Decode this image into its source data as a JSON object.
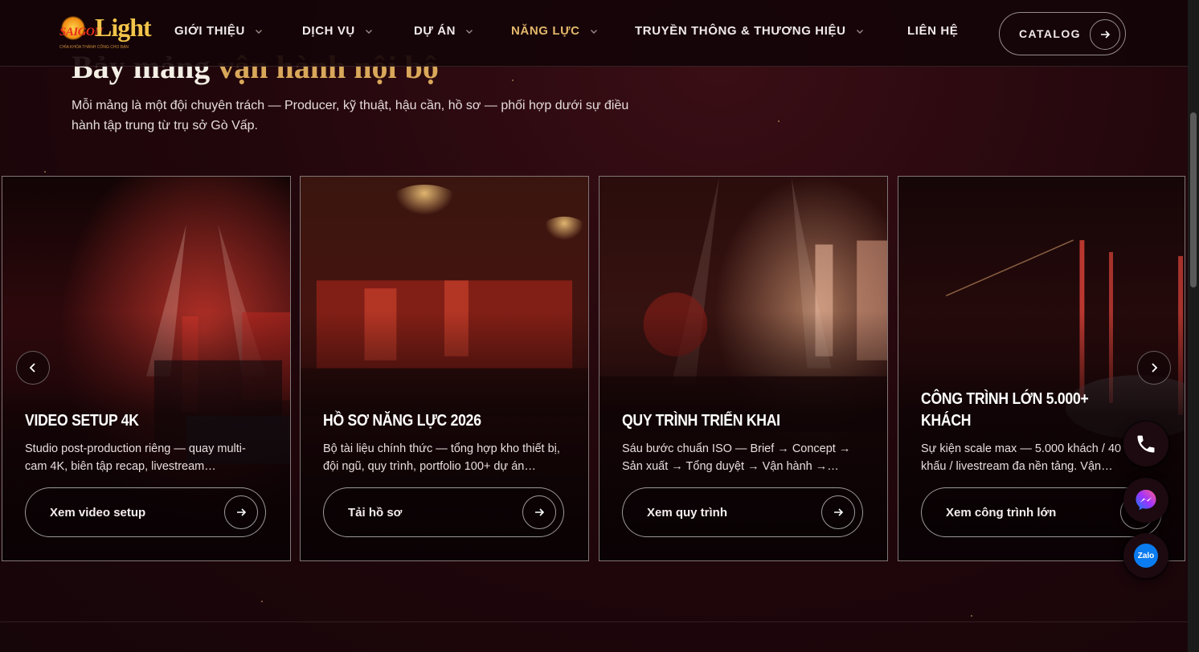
{
  "brand": {
    "name_left": "SAIGON",
    "name_right": "Light",
    "tagline": "CHÌA KHÓA THÀNH CÔNG CHO BẠN"
  },
  "nav": {
    "items": [
      {
        "label": "GIỚI THIỆU",
        "has_dropdown": true,
        "active": false
      },
      {
        "label": "DỊCH VỤ",
        "has_dropdown": true,
        "active": false
      },
      {
        "label": "DỰ ÁN",
        "has_dropdown": true,
        "active": false
      },
      {
        "label": "NĂNG LỰC",
        "has_dropdown": true,
        "active": true
      },
      {
        "label": "TRUYỀN THÔNG & THƯƠNG HIỆU",
        "has_dropdown": true,
        "active": false
      },
      {
        "label": "LIÊN HỆ",
        "has_dropdown": false,
        "active": false
      }
    ],
    "catalog_label": "CATALOG"
  },
  "section": {
    "heading_plain": "Bảy mảng ",
    "heading_accent": "vận hành nội bộ",
    "subtitle": "Mỗi mảng là một đội chuyên trách — Producer, kỹ thuật, hậu cần, hồ sơ — phối hợp dưới sự điều hành tập trung từ trụ sở Gò Vấp."
  },
  "cards": [
    {
      "title": "VIDEO SETUP 4K",
      "description": "Studio post-production riêng — quay multi-cam 4K, biên tập recap, livestream…",
      "button_label": "Xem video setup"
    },
    {
      "title": "HỒ SƠ NĂNG LỰC 2026",
      "description": "Bộ tài liệu chính thức — tổng hợp kho thiết bị, đội ngũ, quy trình, portfolio 100+ dự án…",
      "button_label": "Tải hồ sơ"
    },
    {
      "title": "QUY TRÌNH TRIỂN KHAI",
      "description": "Sáu bước chuẩn ISO — Brief → Concept → Sản xuất → Tổng duyệt → Vận hành →…",
      "button_label": "Xem quy trình"
    },
    {
      "title": "CÔNG TRÌNH LỚN 5.000+ KHÁCH",
      "description": "Sự kiện scale max — 5.000 khách / 40 sân khấu / livestream đa nền tảng. Vận…",
      "button_label": "Xem công trình lớn"
    }
  ],
  "contact": {
    "zalo_label": "Zalo"
  },
  "colors": {
    "accent": "#d9a85a",
    "nav_active": "#e3b76b",
    "background": "#22070c"
  },
  "icons": [
    "chevron-down-icon",
    "arrow-right-icon",
    "chevron-left-icon",
    "chevron-right-icon",
    "phone-icon",
    "messenger-icon",
    "zalo-icon"
  ]
}
